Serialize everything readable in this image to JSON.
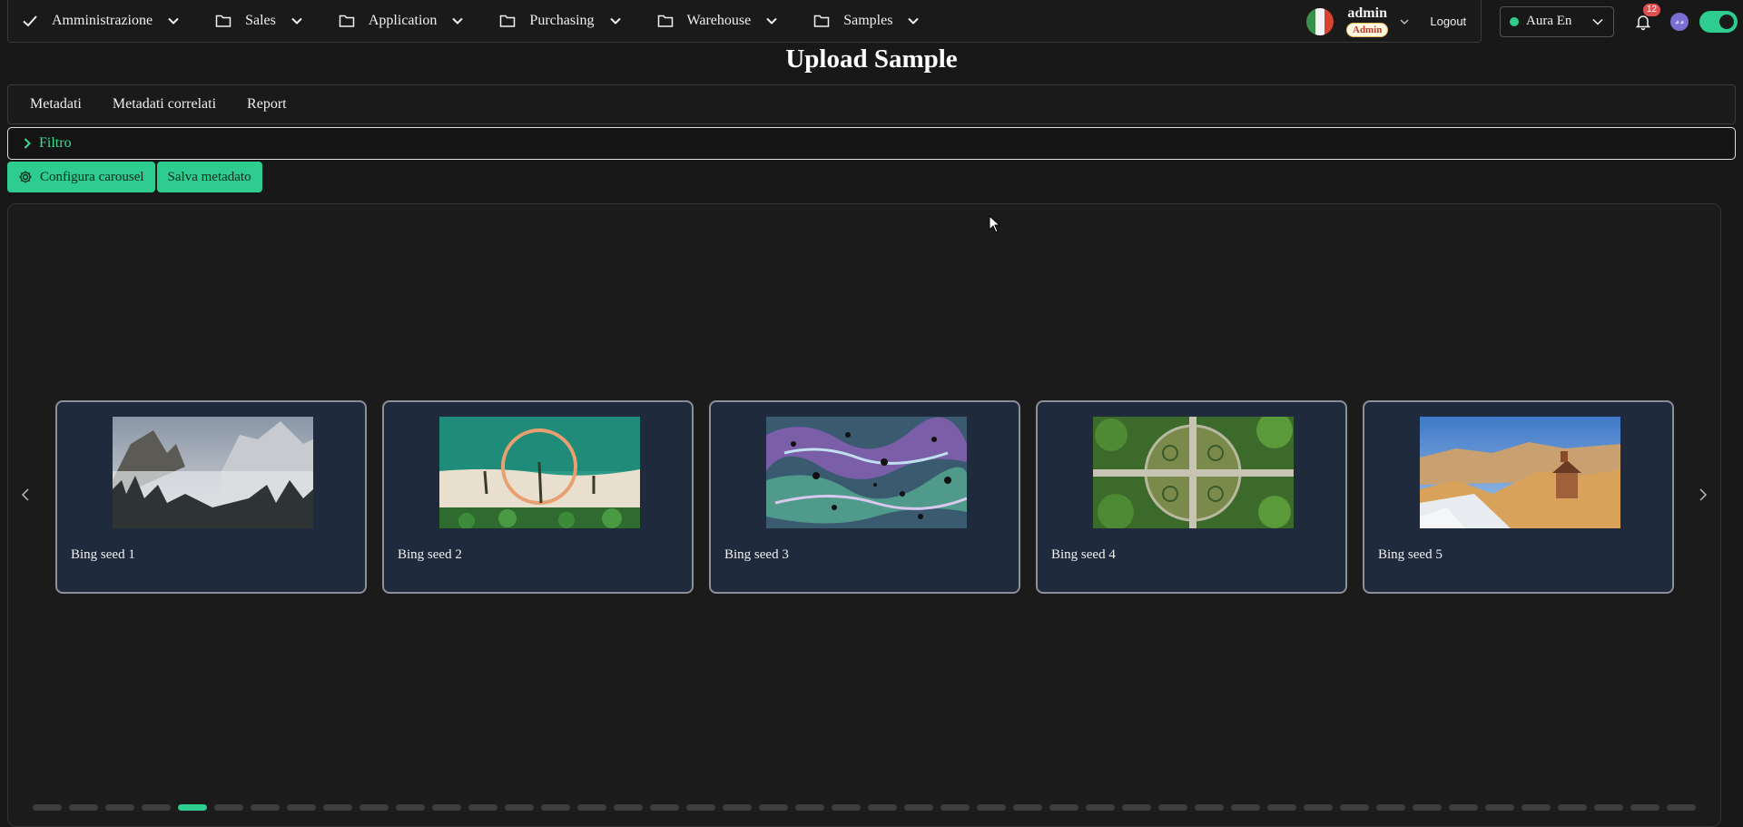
{
  "nav": {
    "items": [
      {
        "label": "Amministrazione",
        "icon": "check-icon"
      },
      {
        "label": "Sales",
        "icon": "folder-icon"
      },
      {
        "label": "Application",
        "icon": "folder-icon"
      },
      {
        "label": "Purchasing",
        "icon": "folder-icon"
      },
      {
        "label": "Warehouse",
        "icon": "folder-icon"
      },
      {
        "label": "Samples",
        "icon": "folder-icon"
      }
    ],
    "user": {
      "name": "admin",
      "role": "Admin"
    },
    "logout_label": "Logout",
    "theme_label": "Aura En",
    "notification_count": "12"
  },
  "page": {
    "title": "Upload Sample"
  },
  "tabs": [
    "Metadati",
    "Metadati correlati",
    "Report"
  ],
  "filter": {
    "label": "Filtro"
  },
  "actions": {
    "configure_label": "Configura carousel",
    "save_label": "Salva metadato"
  },
  "carousel": {
    "cards": [
      {
        "caption": "Bing seed 1",
        "image": "misty-mountain-valley"
      },
      {
        "caption": "Bing seed 2",
        "image": "aerial-beach-ring"
      },
      {
        "caption": "Bing seed 3",
        "image": "abalone-shell-texture"
      },
      {
        "caption": "Bing seed 4",
        "image": "aerial-circular-garden"
      },
      {
        "caption": "Bing seed 5",
        "image": "mountain-chapel-sunset"
      }
    ],
    "total_slides": 46,
    "active_slide": 5
  },
  "colors": {
    "accent": "#2ecc8f",
    "background": "#181818",
    "card": "#1f2a3d"
  }
}
